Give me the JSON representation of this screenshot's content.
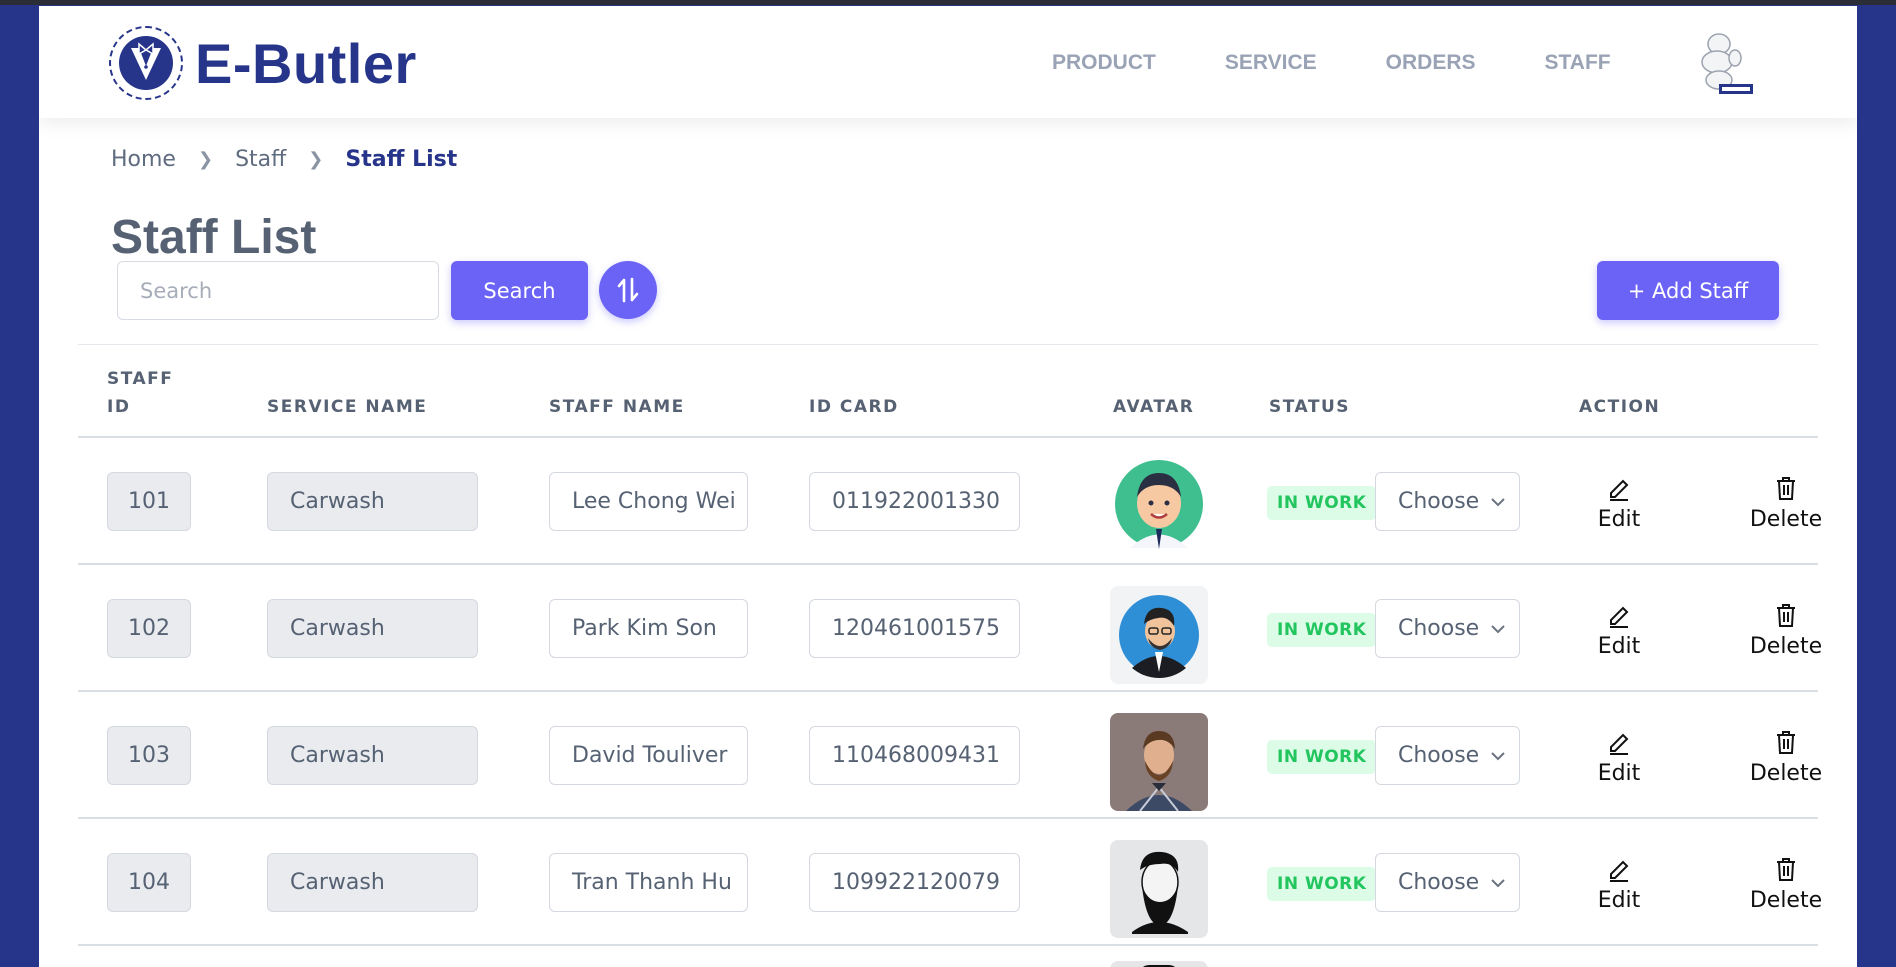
{
  "app": {
    "name": "E-Butler"
  },
  "nav": [
    {
      "label": "PRODUCT"
    },
    {
      "label": "SERVICE"
    },
    {
      "label": "ORDERS"
    },
    {
      "label": "STAFF"
    }
  ],
  "breadcrumb": {
    "home": "Home",
    "section": "Staff",
    "current": "Staff List"
  },
  "page": {
    "title": "Staff List"
  },
  "toolbar": {
    "search_placeholder": "Search",
    "search_value": "",
    "search_label": "Search",
    "add_label": "+ Add Staff"
  },
  "table": {
    "headers": {
      "staff_id_1": "STAFF",
      "staff_id_2": "ID",
      "service": "SERVICE NAME",
      "name": "STAFF NAME",
      "card": "ID CARD",
      "avatar": "AVATAR",
      "status": "STATUS",
      "action": "ACTION"
    },
    "rows": [
      {
        "id": "101",
        "service": "Carwash",
        "name": "Lee Chong Wei",
        "card": "011922001330",
        "status": "IN WORK",
        "select": "Choose",
        "edit": "Edit",
        "delete": "Delete"
      },
      {
        "id": "102",
        "service": "Carwash",
        "name": "Park Kim Son",
        "card": "120461001575",
        "status": "IN WORK",
        "select": "Choose",
        "edit": "Edit",
        "delete": "Delete"
      },
      {
        "id": "103",
        "service": "Carwash",
        "name": "David Touliver",
        "card": "110468009431",
        "status": "IN WORK",
        "select": "Choose",
        "edit": "Edit",
        "delete": "Delete"
      },
      {
        "id": "104",
        "service": "Carwash",
        "name": "Tran Thanh Hu",
        "card": "109922120079",
        "status": "IN WORK",
        "select": "Choose",
        "edit": "Edit",
        "delete": "Delete"
      }
    ]
  },
  "colors": {
    "brand": "#26358a",
    "accent": "#6b63f5",
    "status_bg": "#dcfce7",
    "status_text": "#22c55e"
  }
}
